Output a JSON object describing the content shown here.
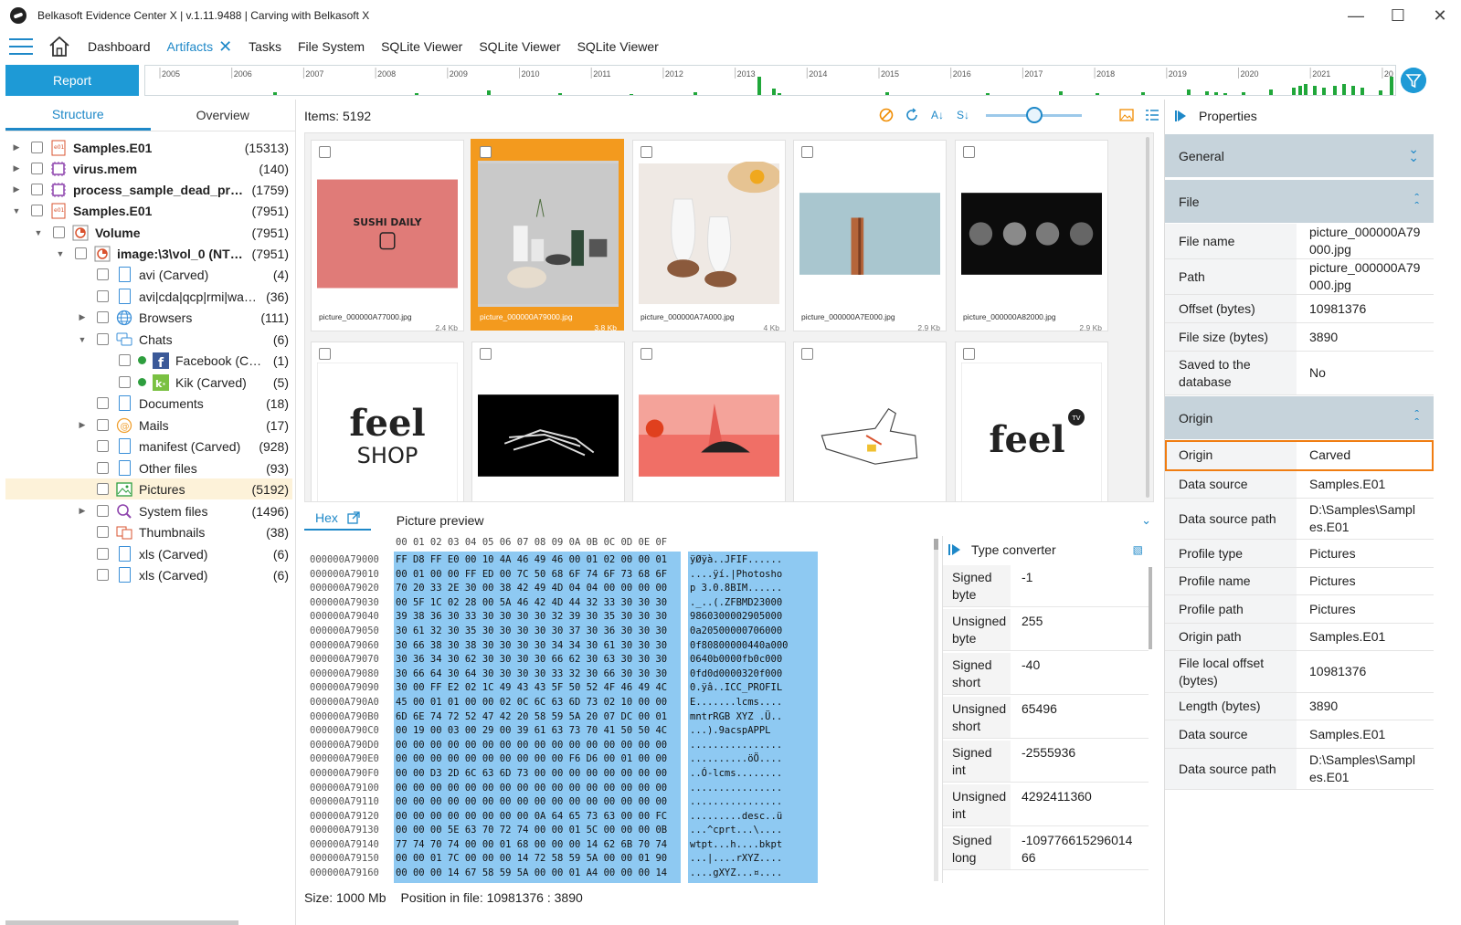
{
  "window": {
    "title": "Belkasoft Evidence Center X | v.1.11.9488 | Carving with Belkasoft X"
  },
  "menu": {
    "tabs": [
      {
        "label": "Dashboard"
      },
      {
        "label": "Artifacts"
      },
      {
        "label": "Tasks"
      },
      {
        "label": "File System"
      },
      {
        "label": "SQLite Viewer"
      },
      {
        "label": "SQLite Viewer"
      },
      {
        "label": "SQLite Viewer"
      }
    ]
  },
  "toolbar": {
    "report_label": "Report"
  },
  "timeline": {
    "years": [
      "2005",
      "2006",
      "2007",
      "2008",
      "2009",
      "2010",
      "2011",
      "2012",
      "2013",
      "2014",
      "2015",
      "2016",
      "2017",
      "2018",
      "2019",
      "2020",
      "2021",
      "20"
    ],
    "bar_color": "#20a73a"
  },
  "left": {
    "tabs": [
      {
        "label": "Structure"
      },
      {
        "label": "Overview"
      }
    ],
    "tree": [
      {
        "label": "Samples.E01",
        "count": "(15313)",
        "bold": true
      },
      {
        "label": "virus.mem",
        "count": "(140)",
        "bold": true
      },
      {
        "label": "process_sample_dead_proces...",
        "count": "(1759)",
        "bold": true
      },
      {
        "label": "Samples.E01",
        "count": "(7951)",
        "bold": true
      },
      {
        "label": "Volume",
        "count": "(7951)",
        "bold": true
      },
      {
        "label": "image:\\3\\vol_0 (NTFS)",
        "count": "(7951)",
        "bold": true
      },
      {
        "label": "avi (Carved)",
        "count": "(4)"
      },
      {
        "label": "avi|cda|qcp|rmi|wav|...",
        "count": "(36)"
      },
      {
        "label": "Browsers",
        "count": "(111)"
      },
      {
        "label": "Chats",
        "count": "(6)"
      },
      {
        "label": "Facebook (Car...",
        "count": "(1)"
      },
      {
        "label": "Kik (Carved)",
        "count": "(5)"
      },
      {
        "label": "Documents",
        "count": "(18)"
      },
      {
        "label": "Mails",
        "count": "(17)"
      },
      {
        "label": "manifest (Carved)",
        "count": "(928)"
      },
      {
        "label": "Other files",
        "count": "(93)"
      },
      {
        "label": "Pictures",
        "count": "(5192)"
      },
      {
        "label": "System files",
        "count": "(1496)"
      },
      {
        "label": "Thumbnails",
        "count": "(38)"
      },
      {
        "label": "xls (Carved)",
        "count": "(6)"
      },
      {
        "label": "xls (Carved)",
        "count": "(6)"
      }
    ]
  },
  "center": {
    "items_label": "Items: 5192",
    "thumbnails": [
      {
        "name": "picture_000000A77000.jpg",
        "size": "2.4 Kb",
        "image_text": "SUSHI DAILY"
      },
      {
        "name": "picture_000000A79000.jpg",
        "size": "3.8 Kb"
      },
      {
        "name": "picture_000000A7A000.jpg",
        "size": "4 Kb"
      },
      {
        "name": "picture_000000A7E000.jpg",
        "size": "2.9 Kb"
      },
      {
        "name": "picture_000000A82000.jpg",
        "size": "2.9 Kb"
      },
      {
        "name": "",
        "size": "",
        "image_text": "feel",
        "image_text2": "SHOP"
      },
      {
        "name": "",
        "size": ""
      },
      {
        "name": "",
        "size": ""
      },
      {
        "name": "",
        "size": ""
      },
      {
        "name": "",
        "size": "",
        "image_text": "feel",
        "image_text2": "TV"
      }
    ],
    "bottom_tabs": [
      {
        "label": "Hex"
      },
      {
        "label": "Picture preview"
      }
    ],
    "hex": {
      "header": "00 01 02 03 04 05 06 07 08 09 0A 0B 0C 0D 0E 0F",
      "offsets": "000000A79000\n000000A79010\n000000A79020\n000000A79030\n000000A79040\n000000A79050\n000000A79060\n000000A79070\n000000A79080\n000000A79090\n000000A790A0\n000000A790B0\n000000A790C0\n000000A790D0\n000000A790E0\n000000A790F0\n000000A79100\n000000A79110\n000000A79120\n000000A79130\n000000A79140\n000000A79150\n000000A79160",
      "bytes": "FF D8 FF E0 00 10 4A 46 49 46 00 01 02 00 00 01\n00 01 00 00 FF ED 00 7C 50 68 6F 74 6F 73 68 6F\n70 20 33 2E 30 00 38 42 49 4D 04 04 00 00 00 00\n00 5F 1C 02 28 00 5A 46 42 4D 44 32 33 30 30 30\n39 38 36 30 33 30 30 30 30 32 39 30 35 30 30 30\n30 61 32 30 35 30 30 30 30 30 37 30 36 30 30 30\n30 66 38 30 38 30 30 30 30 34 34 30 61 30 30 30\n30 36 34 30 62 30 30 30 30 66 62 30 63 30 30 30\n30 66 64 30 64 30 30 30 30 33 32 30 66 30 30 30\n30 00 FF E2 02 1C 49 43 43 5F 50 52 4F 46 49 4C\n45 00 01 01 00 00 02 0C 6C 63 6D 73 02 10 00 00\n6D 6E 74 72 52 47 42 20 58 59 5A 20 07 DC 00 01\n00 19 00 03 00 29 00 39 61 63 73 70 41 50 50 4C\n00 00 00 00 00 00 00 00 00 00 00 00 00 00 00 00\n00 00 00 00 00 00 00 00 00 00 F6 D6 00 01 00 00\n00 00 D3 2D 6C 63 6D 73 00 00 00 00 00 00 00 00\n00 00 00 00 00 00 00 00 00 00 00 00 00 00 00 00\n00 00 00 00 00 00 00 00 00 00 00 00 00 00 00 00\n00 00 00 00 00 00 00 00 0A 64 65 73 63 00 00 FC\n00 00 00 5E 63 70 72 74 00 00 01 5C 00 00 00 0B\n77 74 70 74 00 00 01 68 00 00 00 14 62 6B 70 74\n00 00 01 7C 00 00 00 14 72 58 59 5A 00 00 01 90\n00 00 00 14 67 58 59 5A 00 00 01 A4 00 00 00 14",
      "ascii": "ÿØÿà..JFIF......\n....ÿí.|Photosho\np 3.0.8BIM......\n._..(.ZFBMD23000\n9860300002905000\n0a20500000706000\n0f80800000440a000\n0640b0000fb0c000\n0fd0d0000320f000\n0.ÿâ..ICC_PROFIL\nE.......lcms....\nmntrRGB XYZ .Ü..\n...).9acspAPPL\n................\n..........öÖ....\n..Ó-lcms........\n................\n................\n.........desc..ü\n...^cprt...\\....\nwtpt...h....bkpt\n...|....rXYZ....\n....gXYZ...¤...."
    },
    "type_converter": {
      "title": "Type converter",
      "rows": [
        {
          "k": "Signed byte",
          "v": "-1"
        },
        {
          "k": "Unsigned byte",
          "v": "255"
        },
        {
          "k": "Signed short",
          "v": "-40"
        },
        {
          "k": "Unsigned short",
          "v": "65496"
        },
        {
          "k": "Signed int",
          "v": "-2555936"
        },
        {
          "k": "Unsigned int",
          "v": "4292411360"
        },
        {
          "k": "Signed long",
          "v": "-10977661529601466"
        }
      ]
    },
    "status": {
      "size": "Size: 1000 Mb",
      "position": "Position in file: 10981376 : 3890"
    }
  },
  "properties": {
    "title": "Properties",
    "sections": {
      "general": "General",
      "file": "File",
      "origin": "Origin"
    },
    "file_rows": [
      {
        "k": "File name",
        "v": "picture_000000A79000.jpg"
      },
      {
        "k": "Path",
        "v": "picture_000000A79000.jpg"
      },
      {
        "k": "Offset (bytes)",
        "v": "10981376"
      },
      {
        "k": "File size (bytes)",
        "v": "3890"
      },
      {
        "k": "Saved to the database",
        "v": "No"
      }
    ],
    "origin_rows": [
      {
        "k": "Origin",
        "v": "Carved"
      },
      {
        "k": "Data source",
        "v": "Samples.E01"
      },
      {
        "k": "Data source path",
        "v": "D:\\Samples\\Samples.E01"
      },
      {
        "k": "Profile type",
        "v": "Pictures"
      },
      {
        "k": "Profile name",
        "v": "Pictures"
      },
      {
        "k": "Profile path",
        "v": "Pictures"
      },
      {
        "k": "Origin path",
        "v": "Samples.E01"
      },
      {
        "k": "File local offset (bytes)",
        "v": "10981376"
      },
      {
        "k": "Length (bytes)",
        "v": "3890"
      },
      {
        "k": "Data source",
        "v": "Samples.E01"
      },
      {
        "k": "Data source path",
        "v": "D:\\Samples\\Samples.E01"
      }
    ]
  },
  "colors": {
    "accent": "#1e88c8",
    "selection": "#f39a1e",
    "highlight_border": "#f07d12"
  }
}
